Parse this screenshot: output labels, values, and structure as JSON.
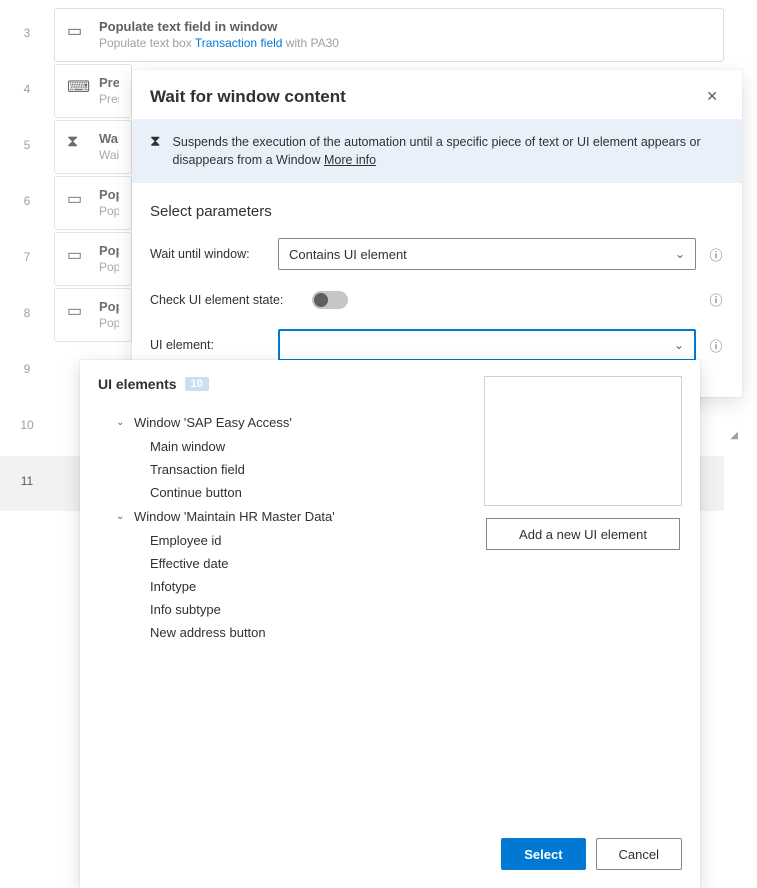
{
  "steps": [
    {
      "num": "3",
      "icon": "window",
      "title": "Populate text field in window",
      "sub_prefix": "Populate text box ",
      "sub_link": "Transaction field",
      "sub_suffix": " with PA30"
    },
    {
      "num": "4",
      "icon": "keyboard",
      "title": "Pres",
      "sub_prefix": "Pres"
    },
    {
      "num": "5",
      "icon": "hourglass",
      "title": "Wai",
      "sub_prefix": "Wait"
    },
    {
      "num": "6",
      "icon": "window",
      "title": "Pop",
      "sub_prefix": "Popu"
    },
    {
      "num": "7",
      "icon": "window",
      "title": "Pop",
      "sub_prefix": "Popu"
    },
    {
      "num": "8",
      "icon": "window",
      "title": "Pop",
      "sub_prefix": "Popu"
    },
    {
      "num": "9",
      "icon": "",
      "title": "",
      "sub_prefix": ""
    },
    {
      "num": "10",
      "icon": "",
      "title": "",
      "sub_prefix": ""
    },
    {
      "num": "11",
      "icon": "",
      "title": "",
      "sub_prefix": ""
    }
  ],
  "dialog": {
    "title": "Wait for window content",
    "banner": "Suspends the execution of the automation until a specific piece of text or UI element appears or disappears from a Window ",
    "more": "More info",
    "section": "Select parameters",
    "labels": {
      "wait_until": "Wait until window:",
      "check_state": "Check UI element state:",
      "ui_element": "UI element:"
    },
    "wait_value": "Contains UI element"
  },
  "panel": {
    "title": "UI elements",
    "badge": "10",
    "groups": [
      {
        "label": "Window 'SAP Easy Access'",
        "children": [
          "Main window",
          "Transaction field",
          "Continue button"
        ]
      },
      {
        "label": "Window 'Maintain HR Master Data'",
        "children": [
          "Employee id",
          "Effective date",
          "Infotype",
          "Info subtype",
          "New address button"
        ]
      }
    ],
    "add": "Add a new UI element",
    "select": "Select",
    "cancel": "Cancel"
  }
}
